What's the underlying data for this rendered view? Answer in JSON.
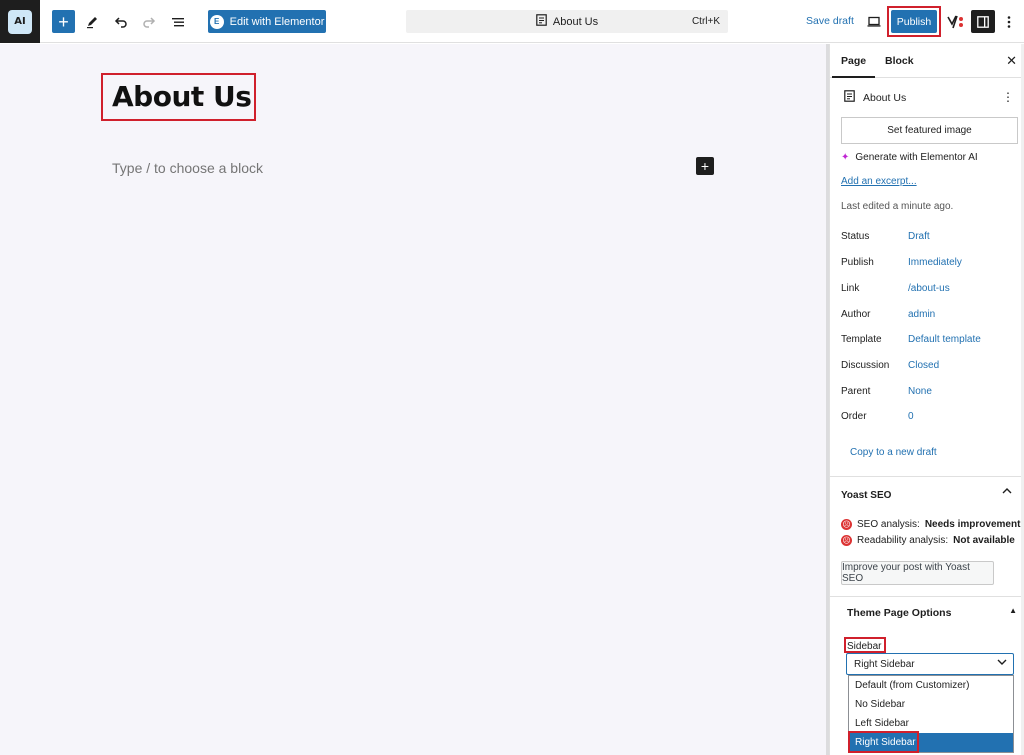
{
  "topbar": {
    "site_logo_text": "AI",
    "add_block_label": "+",
    "edit_with_elementor_label": "Edit with Elementor",
    "document_title": "About Us",
    "document_shortcut": "Ctrl+K",
    "save_draft_label": "Save draft",
    "publish_label": "Publish",
    "accent_color": "#2271b1"
  },
  "editor": {
    "title": "About Us",
    "block_placeholder": "Type / to choose a block",
    "inserter_label": "+"
  },
  "sidebar": {
    "tabs": [
      {
        "label": "Page",
        "active": true
      },
      {
        "label": "Block",
        "active": false
      }
    ],
    "close_label": "✕",
    "document_name": "About Us",
    "featured_image_label": "Set featured image",
    "generate_ai_label": "Generate with Elementor AI",
    "add_excerpt_label": "Add an excerpt...",
    "last_edited": "Last edited a minute ago.",
    "meta": [
      {
        "key": "Status",
        "value": "Draft"
      },
      {
        "key": "Publish",
        "value": "Immediately"
      },
      {
        "key": "Link",
        "value": "/about-us"
      },
      {
        "key": "Author",
        "value": "admin"
      },
      {
        "key": "Template",
        "value": "Default template"
      },
      {
        "key": "Discussion",
        "value": "Closed"
      },
      {
        "key": "Parent",
        "value": "None"
      },
      {
        "key": "Order",
        "value": "0"
      }
    ],
    "copy_draft_label": "Copy to a new draft",
    "yoast": {
      "title": "Yoast SEO",
      "seo_label": "SEO analysis:",
      "seo_value": "Needs improvement",
      "readability_label": "Readability analysis:",
      "readability_value": "Not available",
      "improve_label": "Improve your post with Yoast SEO"
    },
    "theme_options": {
      "title": "Theme Page Options",
      "sidebar_label": "Sidebar",
      "selected": "Right Sidebar",
      "options": [
        "Default (from Customizer)",
        "No Sidebar",
        "Left Sidebar",
        "Right Sidebar"
      ]
    }
  }
}
